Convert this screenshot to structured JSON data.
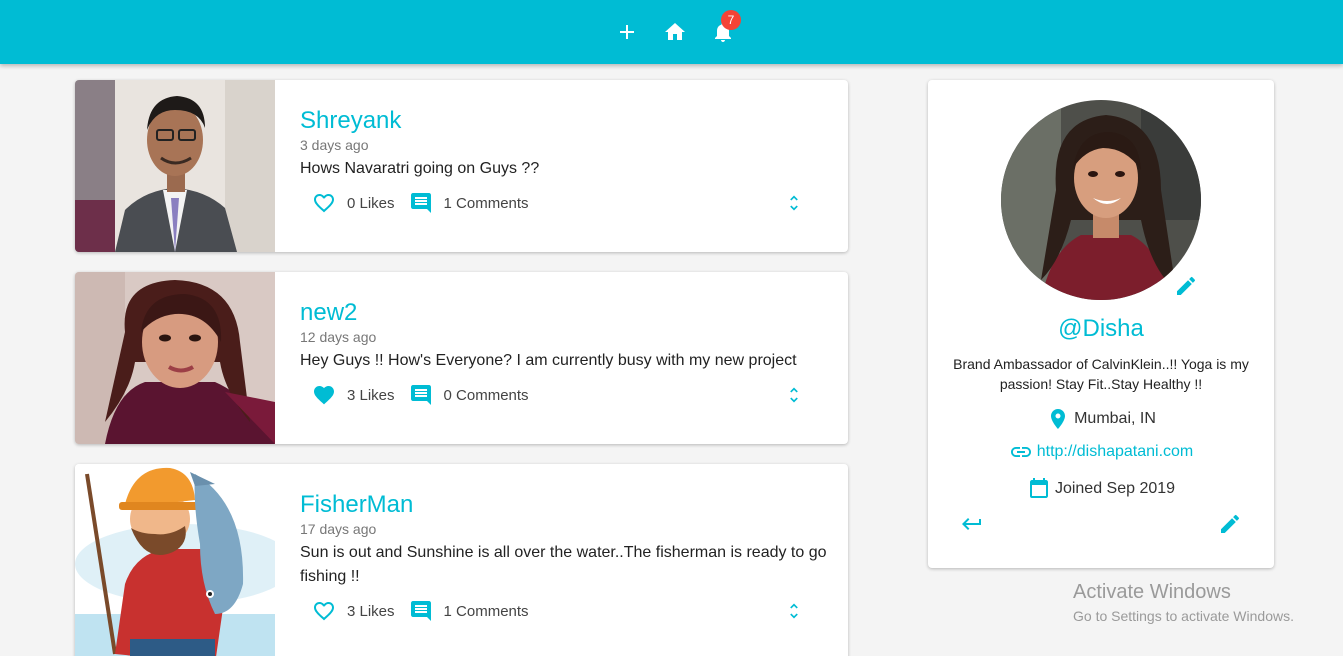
{
  "header": {
    "add_icon": "plus-icon",
    "home_icon": "home-icon",
    "notifications_icon": "bell-icon",
    "notification_count": "7",
    "background_color": "#00bcd4"
  },
  "posts": [
    {
      "user": "Shreyank",
      "time": "3 days ago",
      "text": "Hows Navaratri going on Guys ??",
      "likes": "0 Likes",
      "liked": false,
      "comments": "1 Comments"
    },
    {
      "user": "new2",
      "time": "12 days ago",
      "text": "Hey Guys !! How's Everyone? I am currently busy with my new project",
      "likes": "3 Likes",
      "liked": true,
      "comments": "0 Comments"
    },
    {
      "user": "FisherMan",
      "time": "17 days ago",
      "text": "Sun is out and Sunshine is all over the water..The fisherman is ready to go fishing !!",
      "likes": "3 Likes",
      "liked": false,
      "comments": "1 Comments"
    }
  ],
  "profile": {
    "handle": "@Disha",
    "bio": "Brand Ambassador of CalvinKlein..!! Yoga is my passion! Stay Fit..Stay Healthy !!",
    "location": "Mumbai, IN",
    "website": "http://dishapatani.com",
    "joined": "Joined Sep 2019"
  },
  "watermark": {
    "title": "Activate Windows",
    "subtitle": "Go to Settings to activate Windows."
  },
  "colors": {
    "accent": "#00bcd4",
    "badge": "#f44336"
  }
}
